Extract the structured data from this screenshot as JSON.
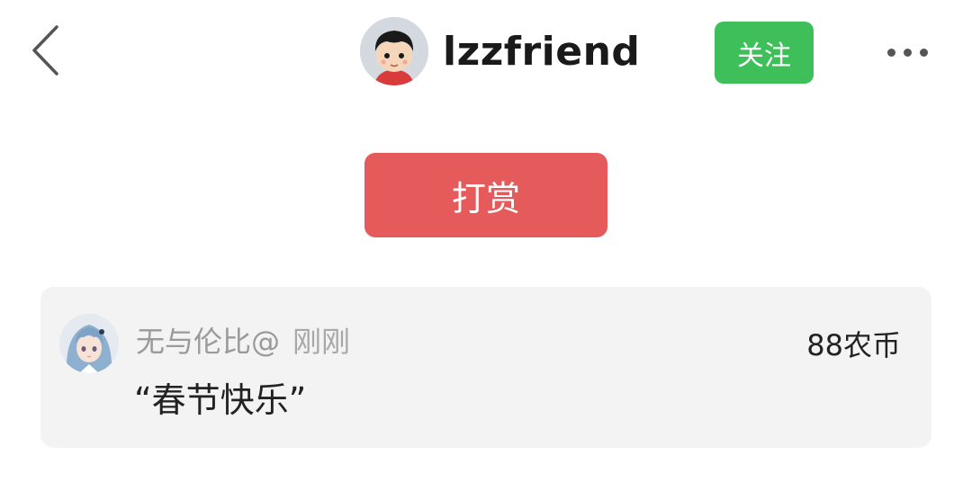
{
  "header": {
    "back_icon": "chevron-left-icon",
    "username": "lzzfriend",
    "follow_label": "关注",
    "more_icon": "more-horizontal-icon",
    "colors": {
      "follow_bg": "#3fbf59"
    }
  },
  "tip": {
    "button_label": "打赏",
    "color": "#e55a5a"
  },
  "records": [
    {
      "user": "无与伦比@",
      "time": "刚刚",
      "amount": "88农币",
      "message": "“春节快乐”"
    }
  ]
}
